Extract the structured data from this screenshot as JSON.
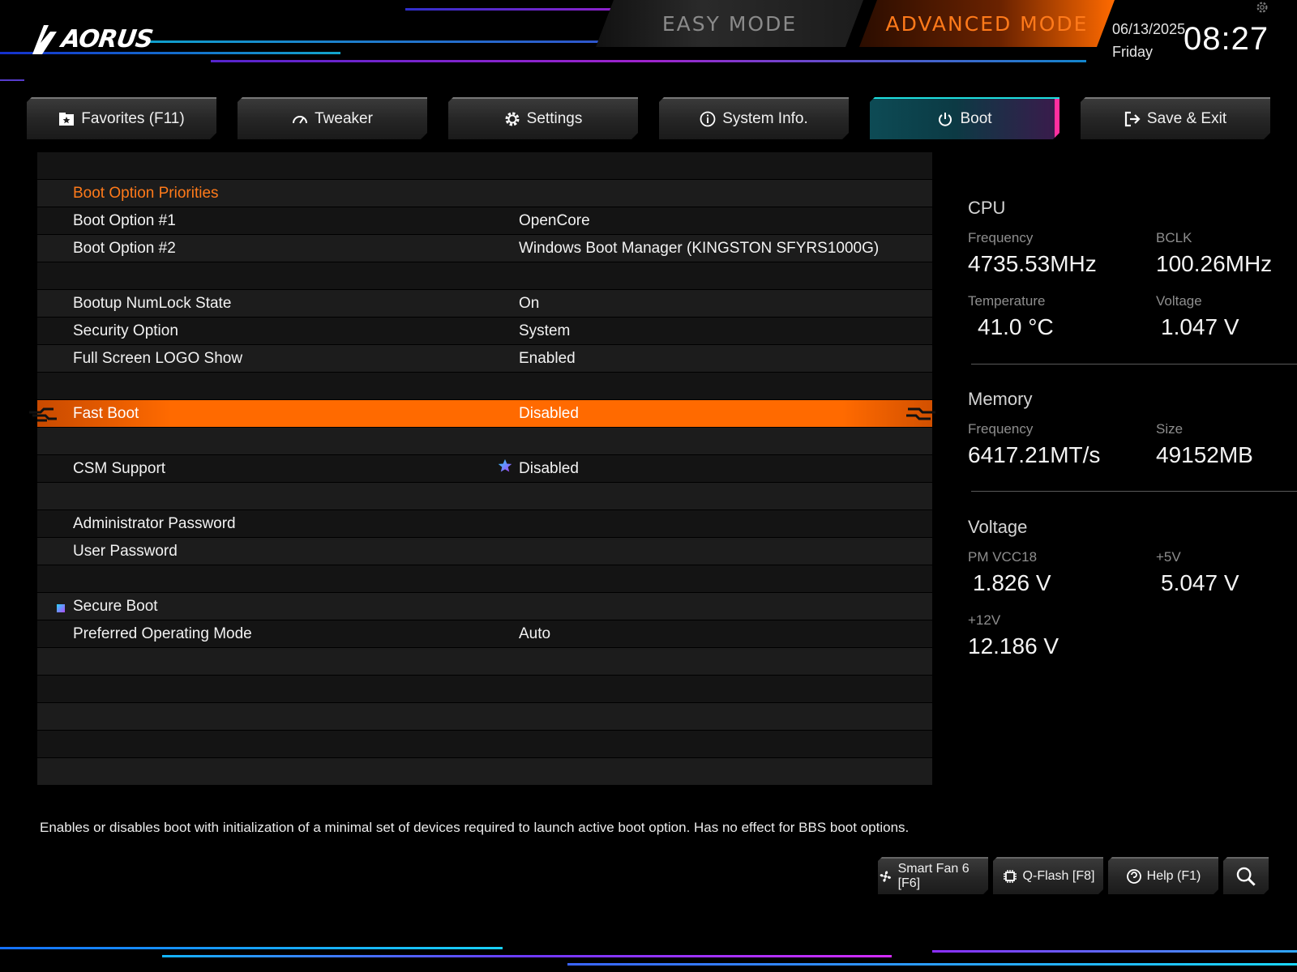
{
  "header": {
    "brand": "AORUS",
    "easy_mode": "EASY MODE",
    "advanced_mode": "ADVANCED MODE",
    "date": "06/13/2025",
    "day": "Friday",
    "time": "08:27",
    "accent_color": "#ff6a00"
  },
  "tabs": [
    {
      "label": "Favorites (F11)",
      "icon": "star-folder-icon"
    },
    {
      "label": "Tweaker",
      "icon": "speedometer-icon"
    },
    {
      "label": "Settings",
      "icon": "gear-icon"
    },
    {
      "label": "System Info.",
      "icon": "info-icon"
    },
    {
      "label": "Boot",
      "icon": "power-icon",
      "active": true
    },
    {
      "label": "Save & Exit",
      "icon": "exit-icon"
    }
  ],
  "settings": {
    "boot_option_priorities": "Boot Option Priorities",
    "boot_option_1": {
      "label": "Boot Option #1",
      "value": "OpenCore"
    },
    "boot_option_2": {
      "label": "Boot Option #2",
      "value": "Windows Boot Manager (KINGSTON SFYRS1000G)"
    },
    "numlock": {
      "label": "Bootup NumLock State",
      "value": "On"
    },
    "security": {
      "label": "Security Option",
      "value": "System"
    },
    "logo": {
      "label": "Full Screen LOGO Show",
      "value": "Enabled"
    },
    "fast_boot": {
      "label": "Fast Boot",
      "value": "Disabled"
    },
    "csm": {
      "label": "CSM Support",
      "value": "Disabled"
    },
    "admin_password": {
      "label": "Administrator Password"
    },
    "user_password": {
      "label": "User Password"
    },
    "secure_boot": {
      "label": "Secure Boot"
    },
    "preferred_os": {
      "label": "Preferred Operating Mode",
      "value": "Auto"
    }
  },
  "sidebar": {
    "cpu": {
      "title": "CPU",
      "frequency_label": "Frequency",
      "frequency": "4735.53MHz",
      "bclk_label": "BCLK",
      "bclk": "100.26MHz",
      "temperature_label": "Temperature",
      "temperature": "41.0 °C",
      "voltage_label": "Voltage",
      "voltage": "1.047 V"
    },
    "memory": {
      "title": "Memory",
      "frequency_label": "Frequency",
      "frequency": "6417.21MT/s",
      "size_label": "Size",
      "size": "49152MB"
    },
    "voltage": {
      "title": "Voltage",
      "pm_vcc18_label": "PM VCC18",
      "pm_vcc18": "1.826 V",
      "plus5_label": "+5V",
      "plus5": "5.047 V",
      "plus12_label": "+12V",
      "plus12": "12.186 V"
    }
  },
  "description": "Enables or disables boot with initialization of a minimal set of devices required to launch active boot option. Has no effect for BBS boot options.",
  "footer": {
    "smart_fan": "Smart Fan 6 [F6]",
    "qflash": "Q-Flash [F8]",
    "help": "Help (F1)"
  }
}
